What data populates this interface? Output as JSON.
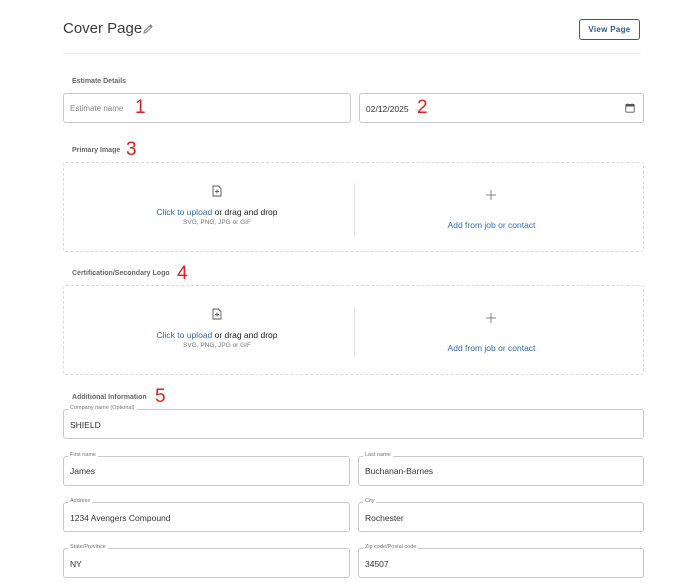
{
  "header": {
    "title": "Cover Page",
    "view_button": "View Page"
  },
  "estimate_details": {
    "label": "Estimate Details",
    "name_placeholder": "Estimate name",
    "date_value": "02/12/2025"
  },
  "primary_image": {
    "label": "Primary Image",
    "upload_link": "Click to upload",
    "upload_rest": " or drag and drop",
    "formats": "SVG, PNG, JPG or GIF",
    "add_from": "Add from job or contact"
  },
  "secondary_logo": {
    "label": "Certification/Secondary Logo",
    "upload_link": "Click to upload",
    "upload_rest": " or drag and drop",
    "formats": "SVG, PNG, JPG or GIF",
    "add_from": "Add from job or contact"
  },
  "additional_info": {
    "label": "Additional Information",
    "company": {
      "label": "Company name (Optional)",
      "value": "SHIELD"
    },
    "first_name": {
      "label": "First name",
      "value": "James"
    },
    "last_name": {
      "label": "Last name",
      "value": "Buchanan-Barnes"
    },
    "address": {
      "label": "Address",
      "value": "1234 Avengers Compound"
    },
    "city": {
      "label": "City",
      "value": "Rochester"
    },
    "state": {
      "label": "State/Province",
      "value": "NY"
    },
    "zip": {
      "label": "Zip code/Postal code",
      "value": "34507"
    }
  },
  "annotations": [
    "1",
    "2",
    "3",
    "4",
    "5"
  ],
  "colors": {
    "accent": "#2a5d8f",
    "link": "#2f6db0",
    "annotation": "#e01e1e"
  }
}
